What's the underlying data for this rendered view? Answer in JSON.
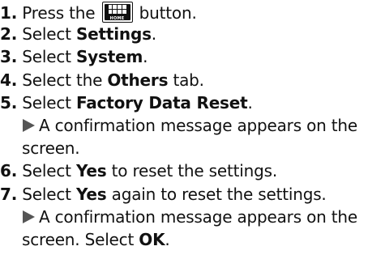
{
  "steps": [
    {
      "num": "1.",
      "pre": "Press the",
      "post": "button."
    },
    {
      "num": "2.",
      "pre": "Select ",
      "bold": "Settings",
      "post": "."
    },
    {
      "num": "3.",
      "pre": "Select ",
      "bold": "System",
      "post": "."
    },
    {
      "num": "4.",
      "pre": "Select the ",
      "bold": "Others",
      "post": " tab."
    },
    {
      "num": "5.",
      "pre": "Select ",
      "bold": "Factory Data Reset",
      "post": ".",
      "result_line1": "A confirmation message appears on the",
      "result_line2": "screen."
    },
    {
      "num": "6.",
      "pre": "Select ",
      "bold": "Yes",
      "post": " to reset the settings."
    },
    {
      "num": "7.",
      "pre": "Select ",
      "bold": "Yes",
      "post": " again to reset the settings.",
      "result_line1": "A confirmation message appears on the",
      "result_line2_pre": "screen. Select ",
      "result_line2_bold": "OK",
      "result_line2_post": "."
    }
  ],
  "home_button": {
    "label": "HOME",
    "icon": "home-grid-icon"
  }
}
